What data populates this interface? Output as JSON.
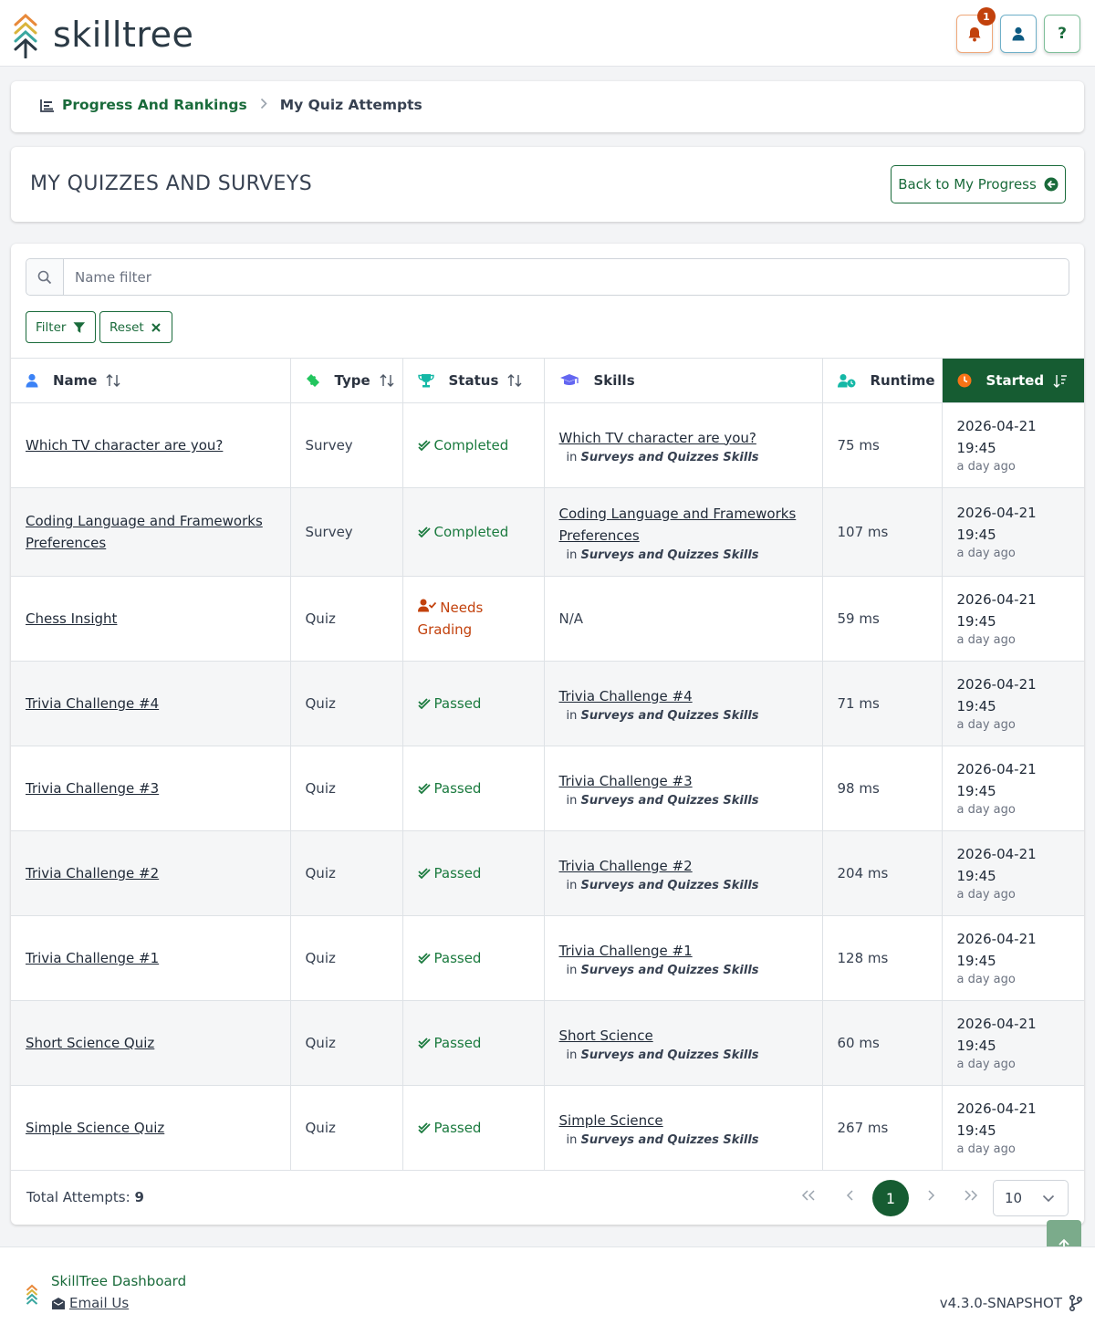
{
  "app": {
    "logo_text": "skilltree",
    "notification_count": "1",
    "help_label": "?"
  },
  "breadcrumb": {
    "parent": "Progress And Rankings",
    "current": "My Quiz Attempts"
  },
  "page": {
    "title": "MY QUIZZES AND SURVEYS",
    "back_label": "Back to My Progress"
  },
  "filters": {
    "search_placeholder": "Name filter",
    "filter_label": "Filter",
    "reset_label": "Reset"
  },
  "table": {
    "headers": {
      "name": "Name",
      "type": "Type",
      "status": "Status",
      "skills": "Skills",
      "runtime": "Runtime",
      "started": "Started"
    },
    "in_label": "in",
    "rows": [
      {
        "name": "Which TV character are you?",
        "type": "Survey",
        "status": "Completed",
        "status_kind": "ok",
        "skill": "Which TV character are you?",
        "project": "Surveys and Quizzes Skills",
        "runtime": "75 ms",
        "date": "2026-04-21",
        "time": "19:45",
        "ago": "a day ago"
      },
      {
        "name": "Coding Language and Frameworks Preferences",
        "type": "Survey",
        "status": "Completed",
        "status_kind": "ok",
        "skill": "Coding Language and Frameworks Preferences",
        "project": "Surveys and Quizzes Skills",
        "runtime": "107 ms",
        "date": "2026-04-21",
        "time": "19:45",
        "ago": "a day ago"
      },
      {
        "name": "Chess Insight",
        "type": "Quiz",
        "status": "Needs Grading",
        "status_kind": "warn",
        "skill": "N/A",
        "project": "",
        "runtime": "59 ms",
        "date": "2026-04-21",
        "time": "19:45",
        "ago": "a day ago"
      },
      {
        "name": "Trivia Challenge #4",
        "type": "Quiz",
        "status": "Passed",
        "status_kind": "ok",
        "skill": "Trivia Challenge #4",
        "project": "Surveys and Quizzes Skills",
        "runtime": "71 ms",
        "date": "2026-04-21",
        "time": "19:45",
        "ago": "a day ago"
      },
      {
        "name": "Trivia Challenge #3",
        "type": "Quiz",
        "status": "Passed",
        "status_kind": "ok",
        "skill": "Trivia Challenge #3",
        "project": "Surveys and Quizzes Skills",
        "runtime": "98 ms",
        "date": "2026-04-21",
        "time": "19:45",
        "ago": "a day ago"
      },
      {
        "name": "Trivia Challenge #2",
        "type": "Quiz",
        "status": "Passed",
        "status_kind": "ok",
        "skill": "Trivia Challenge #2",
        "project": "Surveys and Quizzes Skills",
        "runtime": "204 ms",
        "date": "2026-04-21",
        "time": "19:45",
        "ago": "a day ago"
      },
      {
        "name": "Trivia Challenge #1",
        "type": "Quiz",
        "status": "Passed",
        "status_kind": "ok",
        "skill": "Trivia Challenge #1",
        "project": "Surveys and Quizzes Skills",
        "runtime": "128 ms",
        "date": "2026-04-21",
        "time": "19:45",
        "ago": "a day ago"
      },
      {
        "name": "Short Science Quiz",
        "type": "Quiz",
        "status": "Passed",
        "status_kind": "ok",
        "skill": "Short Science",
        "project": "Surveys and Quizzes Skills",
        "runtime": "60 ms",
        "date": "2026-04-21",
        "time": "19:45",
        "ago": "a day ago"
      },
      {
        "name": "Simple Science Quiz",
        "type": "Quiz",
        "status": "Passed",
        "status_kind": "ok",
        "skill": "Simple Science",
        "project": "Surveys and Quizzes Skills",
        "runtime": "267 ms",
        "date": "2026-04-21",
        "time": "19:45",
        "ago": "a day ago"
      }
    ]
  },
  "pagination": {
    "total_label": "Total Attempts:",
    "total": "9",
    "current_page": "1",
    "page_size": "10"
  },
  "footer": {
    "name": "SkillTree Dashboard",
    "email": "Email Us",
    "version": "v4.3.0-SNAPSHOT"
  },
  "colors": {
    "brand_green": "#165c32",
    "warning": "#c2410c",
    "success": "#1a7a3e"
  }
}
